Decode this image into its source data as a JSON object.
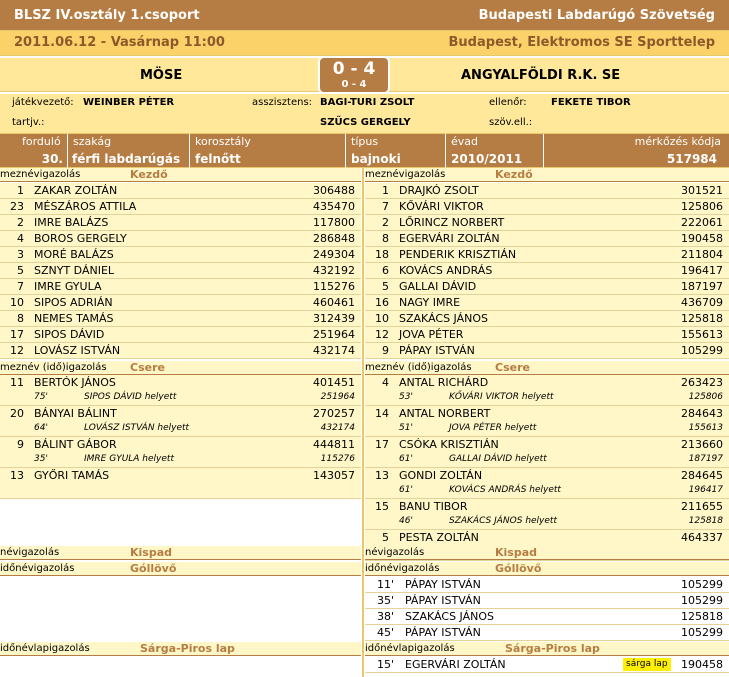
{
  "header": {
    "league": "BLSZ IV.osztály 1.csoport",
    "federation": "Budapesti Labdarúgó Szövetség",
    "datetime": "2011.06.12 - Vasárnap 11:00",
    "venue": "Budapest, Elektromos SE Sporttelep"
  },
  "match": {
    "home": "MÖSE",
    "away": "ANGYALFÖLDI R.K. SE",
    "score": "0 - 4",
    "halftime": "0 - 4"
  },
  "officials": {
    "referee_label": "játékvezető:",
    "referee": "WEINBER PÉTER",
    "assistant_label": "asszisztens:",
    "assistant1": "BAGI-TURI ZSOLT",
    "assistant2": "SZŰCS GERGELY",
    "controller_label": "ellenőr:",
    "controller": "FEKETE TIBOR",
    "tartjv_label": "tartjv.:",
    "szovell_label": "szöv.ell.:"
  },
  "meta": {
    "round_label": "forduló",
    "round": "30.",
    "sport_label": "szakág",
    "sport": "férfi labdarúgás",
    "age_label": "korosztály",
    "age": "felnőtt",
    "type_label": "típus",
    "type": "bajnoki",
    "season_label": "évad",
    "season": "2010/2011",
    "code_label": "mérkőzés kódja",
    "code": "517984"
  },
  "labels": {
    "mez": "mez",
    "nev": "név",
    "nevido": "név (idő)",
    "igazolas": "igazolás",
    "ido": "idő",
    "lap": "lap",
    "kezdo": "Kezdő",
    "csere": "Csere",
    "kispad": "Kispad",
    "gollovo": "Góllövő",
    "sargapiros": "Sárga-Piros lap"
  },
  "home_start": [
    {
      "no": "1",
      "name": "ZAKAR ZOLTÁN",
      "id": "306488"
    },
    {
      "no": "23",
      "name": "MÉSZÁROS ATTILA",
      "id": "435470"
    },
    {
      "no": "2",
      "name": "IMRE BALÁZS",
      "id": "117800"
    },
    {
      "no": "4",
      "name": "BOROS GERGELY",
      "id": "286848"
    },
    {
      "no": "3",
      "name": "MORÉ BALÁZS",
      "id": "249304"
    },
    {
      "no": "5",
      "name": "SZNYT DÁNIEL",
      "id": "432192"
    },
    {
      "no": "7",
      "name": "IMRE GYULA",
      "id": "115276"
    },
    {
      "no": "10",
      "name": "SIPOS ADRIÁN",
      "id": "460461"
    },
    {
      "no": "8",
      "name": "NEMES TAMÁS",
      "id": "312439"
    },
    {
      "no": "17",
      "name": "SIPOS DÁVID",
      "id": "251964"
    },
    {
      "no": "12",
      "name": "LOVÁSZ ISTVÁN",
      "id": "432174"
    }
  ],
  "away_start": [
    {
      "no": "1",
      "name": "DRAJKÓ ZSOLT",
      "id": "301521"
    },
    {
      "no": "7",
      "name": "KŐVÁRI VIKTOR",
      "id": "125806"
    },
    {
      "no": "2",
      "name": "LŐRINCZ NORBERT",
      "id": "222061"
    },
    {
      "no": "8",
      "name": "EGERVÁRI ZOLTÁN",
      "id": "190458"
    },
    {
      "no": "18",
      "name": "PENDERIK KRISZTIÁN",
      "id": "211804"
    },
    {
      "no": "6",
      "name": "KOVÁCS ANDRÁS",
      "id": "196417"
    },
    {
      "no": "5",
      "name": "GALLAI DÁVID",
      "id": "187197"
    },
    {
      "no": "16",
      "name": "NAGY IMRE",
      "id": "436709"
    },
    {
      "no": "10",
      "name": "SZAKÁCS JÁNOS",
      "id": "125818"
    },
    {
      "no": "12",
      "name": "JOVA PÉTER",
      "id": "155613"
    },
    {
      "no": "9",
      "name": "PÁPAY ISTVÁN",
      "id": "105299"
    }
  ],
  "home_subs": [
    {
      "no": "11",
      "name": "BERTÓK JÁNOS",
      "id": "401451",
      "min": "75'",
      "repl": "SIPOS DÁVID helyett",
      "repl_id": "251964"
    },
    {
      "no": "20",
      "name": "BÁNYAI BÁLINT",
      "id": "270257",
      "min": "64'",
      "repl": "LOVÁSZ ISTVÁN helyett",
      "repl_id": "432174"
    },
    {
      "no": "9",
      "name": "BÁLINT GÁBOR",
      "id": "444811",
      "min": "35'",
      "repl": "IMRE GYULA helyett",
      "repl_id": "115276"
    },
    {
      "no": "13",
      "name": "GYŐRI TAMÁS",
      "id": "143057"
    }
  ],
  "away_subs": [
    {
      "no": "4",
      "name": "ANTAL RICHÁRD",
      "id": "263423",
      "min": "53'",
      "repl": "KŐVÁRI VIKTOR helyett",
      "repl_id": "125806"
    },
    {
      "no": "14",
      "name": "ANTAL NORBERT",
      "id": "284643",
      "min": "51'",
      "repl": "JOVA PÉTER helyett",
      "repl_id": "155613"
    },
    {
      "no": "17",
      "name": "CSÓKA KRISZTIÁN",
      "id": "213660",
      "min": "61'",
      "repl": "GALLAI DÁVID helyett",
      "repl_id": "187197"
    },
    {
      "no": "13",
      "name": "GONDI ZOLTÁN",
      "id": "284645",
      "min": "61'",
      "repl": "KOVÁCS ANDRÁS helyett",
      "repl_id": "196417"
    },
    {
      "no": "15",
      "name": "BANU TIBOR",
      "id": "211655",
      "min": "46'",
      "repl": "SZAKÁCS JÁNOS helyett",
      "repl_id": "125818"
    },
    {
      "no": "5",
      "name": "PESTA ZOLTÁN",
      "id": "464337"
    }
  ],
  "away_goals": [
    {
      "min": "11'",
      "name": "PÁPAY ISTVÁN",
      "id": "105299"
    },
    {
      "min": "35'",
      "name": "PÁPAY ISTVÁN",
      "id": "105299"
    },
    {
      "min": "38'",
      "name": "SZAKÁCS JÁNOS",
      "id": "125818"
    },
    {
      "min": "45'",
      "name": "PÁPAY ISTVÁN",
      "id": "105299"
    }
  ],
  "away_cards": [
    {
      "min": "15'",
      "name": "EGERVÁRI ZOLTÁN",
      "card": "sárga lap",
      "id": "190458"
    }
  ],
  "colors": {
    "brown": "#b57d44",
    "yellow": "#ffe89a",
    "light": "#fff7c8",
    "card": "#ffef00"
  }
}
